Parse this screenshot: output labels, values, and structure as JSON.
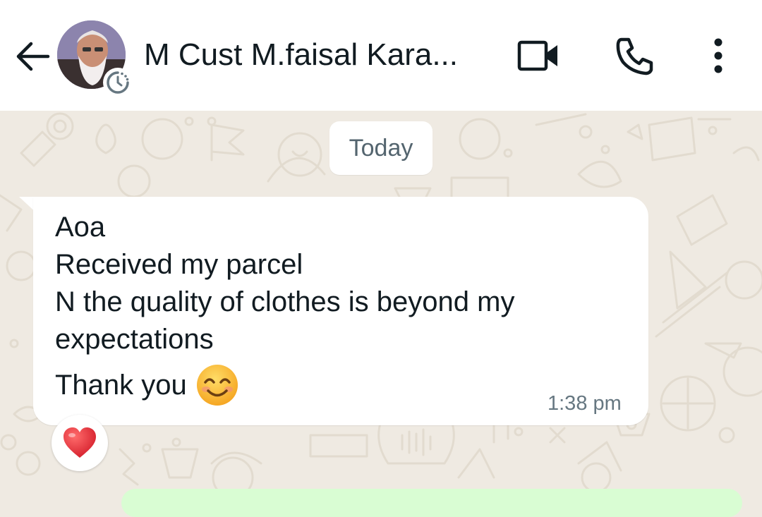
{
  "header": {
    "contact_name": "M Cust M.faisal Kara...",
    "icons": {
      "back": "arrow-left-icon",
      "video": "video-camera-icon",
      "call": "phone-icon",
      "menu": "more-vertical-icon"
    }
  },
  "chat": {
    "date_divider": "Today",
    "message": {
      "lines": [
        "Aoa",
        "Received my parcel",
        "N the quality of clothes is beyond my",
        "expectations"
      ],
      "closing": "Thank you",
      "emoji": "smiling-face-emoji",
      "time": "1:38 pm",
      "reaction": "red-heart-emoji"
    }
  },
  "colors": {
    "header_bg": "#ffffff",
    "chat_bg": "#efeae2",
    "bubble_in": "#ffffff",
    "bubble_out": "#d9fdd3",
    "text": "#111b21",
    "meta": "#667781"
  }
}
